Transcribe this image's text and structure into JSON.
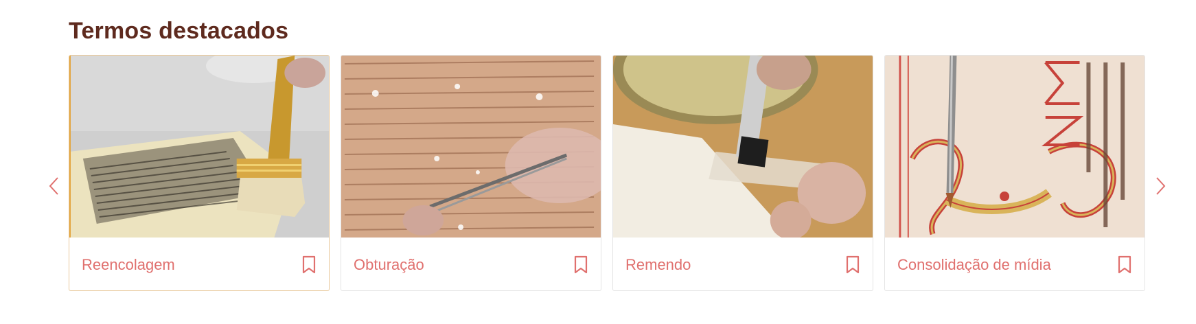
{
  "section": {
    "title": "Termos destacados"
  },
  "carousel": {
    "prev_icon": "chevron-left-icon",
    "next_icon": "chevron-right-icon",
    "accent_color": "#e0706e"
  },
  "cards": [
    {
      "label": "Reencolagem",
      "image": "brush-on-printed-page",
      "action_icon": "bookmark-icon"
    },
    {
      "label": "Obturação",
      "image": "tweezers-on-manuscript",
      "action_icon": "bookmark-icon"
    },
    {
      "label": "Remendo",
      "image": "brush-on-paper-patch",
      "action_icon": "bookmark-icon"
    },
    {
      "label": "Consolidação de mídia",
      "image": "fine-brush-on-illuminated-letter",
      "action_icon": "bookmark-icon"
    }
  ]
}
